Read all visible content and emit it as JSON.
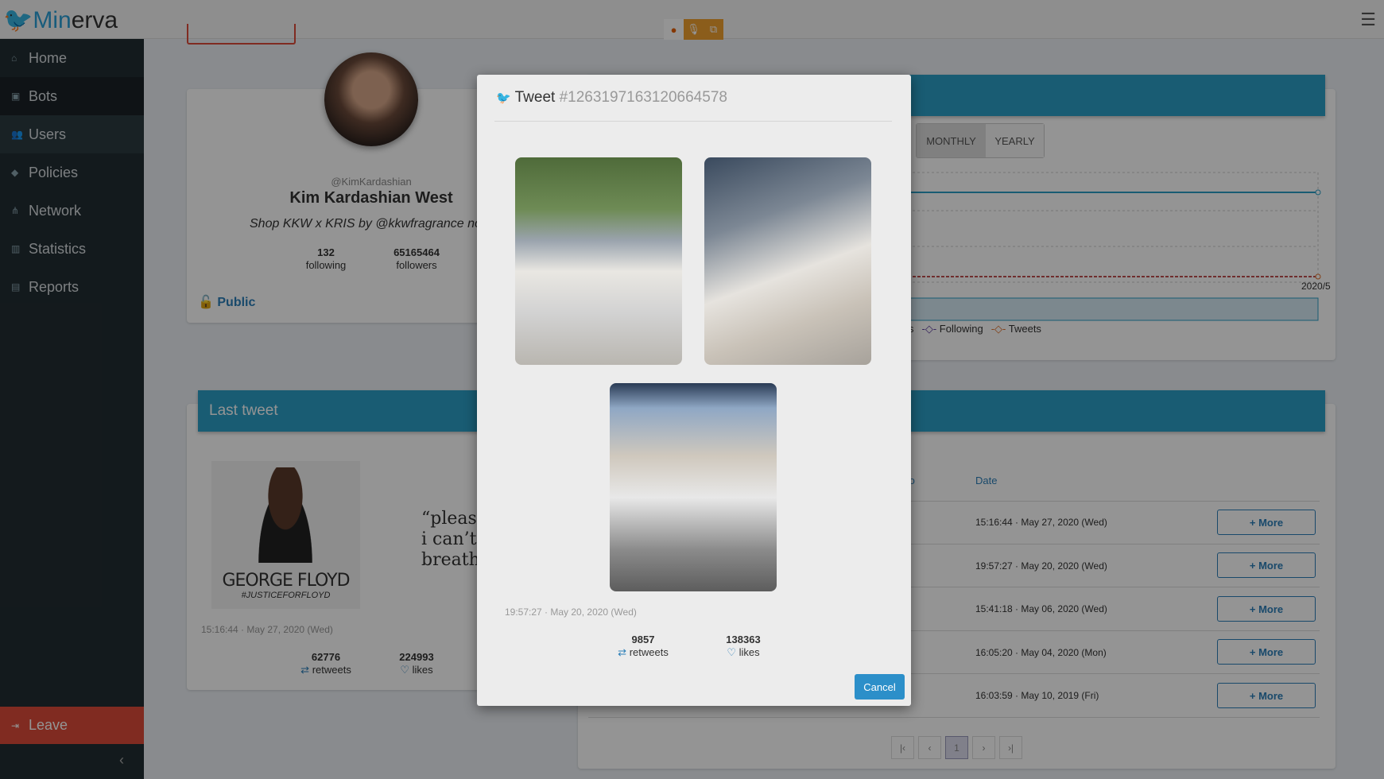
{
  "app": {
    "logo_prefix": "Min",
    "logo_suffix": "erva",
    "menu_icon": "hamburger-icon"
  },
  "extensions": [
    "firefox-icon",
    "microphone-icon",
    "screen-share-icon"
  ],
  "sidebar": {
    "items": [
      {
        "label": "Home",
        "icon": "home-icon"
      },
      {
        "label": "Bots",
        "icon": "robot-icon"
      },
      {
        "label": "Users",
        "icon": "users-icon"
      },
      {
        "label": "Policies",
        "icon": "tags-icon"
      },
      {
        "label": "Network",
        "icon": "network-icon"
      },
      {
        "label": "Statistics",
        "icon": "chart-icon"
      },
      {
        "label": "Reports",
        "icon": "file-icon"
      }
    ],
    "leave": "Leave"
  },
  "profile": {
    "handle": "@KimKardashian",
    "name": "Kim Kardashian West",
    "bio": "Shop KKW x KRIS by @kkwfragrance no",
    "following": "132",
    "following_label": "following",
    "followers": "65165464",
    "followers_label": "followers",
    "visibility": "Public"
  },
  "chart": {
    "tabs": [
      "MONTHLY",
      "YEARLY"
    ],
    "x_label": "2020/5",
    "legend": [
      "s",
      "Following",
      "Tweets"
    ]
  },
  "last_tweet": {
    "title": "Last tweet",
    "date": "15:16:44 · May 27, 2020 (Wed)",
    "retweets": "62776",
    "retweets_label": "retweets",
    "likes": "224993",
    "likes_label": "likes",
    "image_text_1": "GEORGE FLOYD",
    "image_text_2": "#JUSTICEFORFLOYD",
    "image2_text": "“please i can’t breathe"
  },
  "tweets_table": {
    "headers": [
      "to",
      "Date"
    ],
    "rows": [
      {
        "date": "15:16:44 · May 27, 2020 (Wed)"
      },
      {
        "date": "19:57:27 · May 20, 2020 (Wed)"
      },
      {
        "date": "15:41:18 · May 06, 2020 (Wed)"
      },
      {
        "date": "16:05:20 · May 04, 2020 (Mon)"
      },
      {
        "date": "16:03:59 · May 10, 2019 (Fri)"
      }
    ],
    "more_label": "More",
    "pagination": [
      "|‹",
      "‹",
      "1",
      "›",
      "›|"
    ]
  },
  "modal": {
    "title": "Tweet",
    "tweet_id": "#1263197163120664578",
    "date": "19:57:27 · May 20, 2020 (Wed)",
    "retweets": "9857",
    "retweets_label": "retweets",
    "likes": "138363",
    "likes_label": "likes",
    "cancel": "Cancel"
  }
}
